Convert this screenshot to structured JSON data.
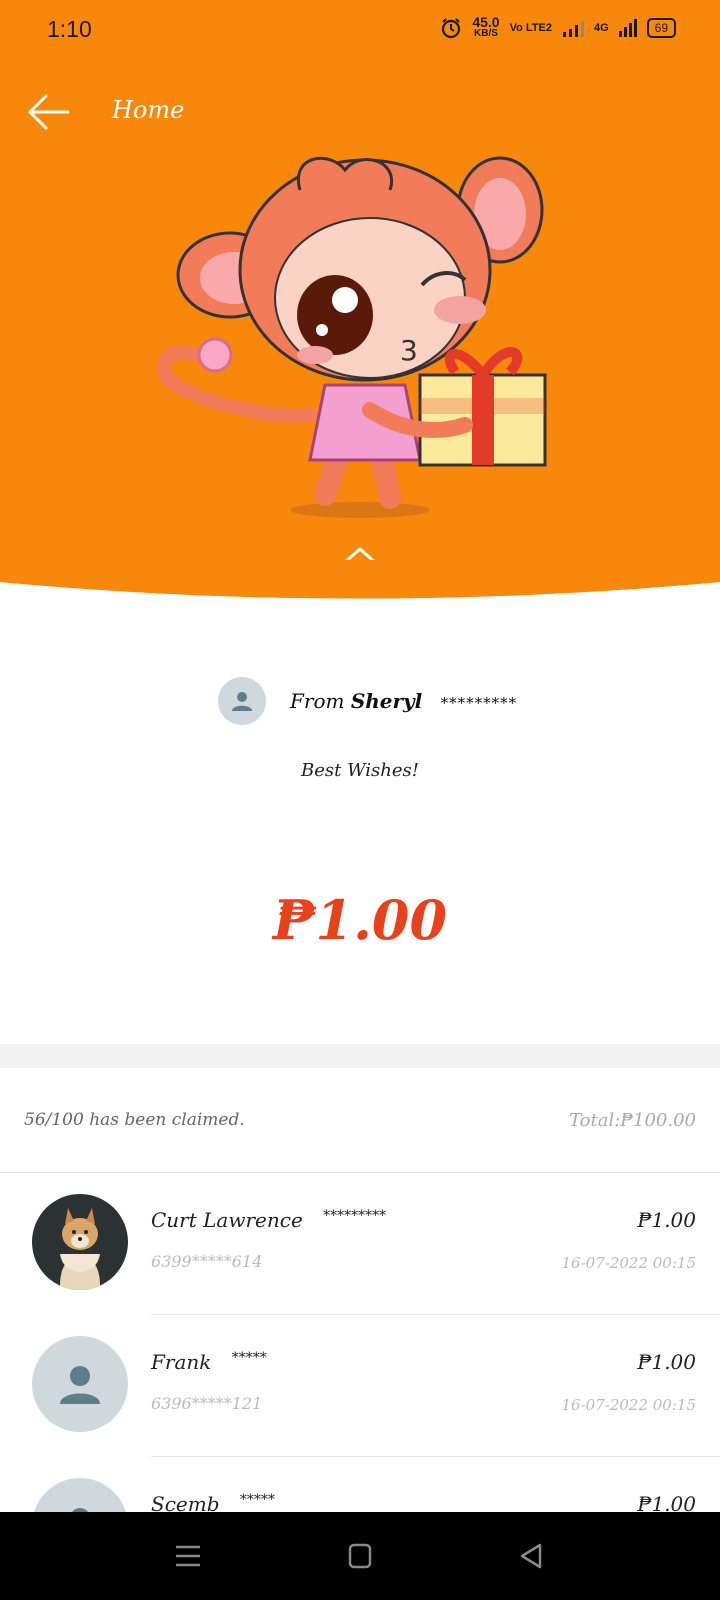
{
  "status_bar": {
    "time": "1:10",
    "speed_value": "45.0",
    "speed_unit": "KB/S",
    "volte": "Vo LTE2",
    "network": "4G",
    "battery": "69"
  },
  "header": {
    "title": "Home"
  },
  "gift": {
    "from_label": "From",
    "sender_name": "Sheryl",
    "sender_mask": "*********",
    "message": "Best Wishes!",
    "amount": "₱1.00"
  },
  "summary": {
    "claimed": "56/100 has been claimed.",
    "total": "Total:₱100.00"
  },
  "claims": [
    {
      "name": "Curt Lawrence",
      "mask": "*********",
      "phone": "6399*****614",
      "amount": "₱1.00",
      "date": "16-07-2022  00:15"
    },
    {
      "name": "Frank",
      "mask": "*****",
      "phone": "6396*****121",
      "amount": "₱1.00",
      "date": "16-07-2022  00:15"
    },
    {
      "name": "Scemb",
      "mask": "*****",
      "phone": "",
      "amount": "₱1.00",
      "date": ""
    }
  ],
  "colors": {
    "header_bg": "#F7880B",
    "amount": "#E8421C"
  }
}
